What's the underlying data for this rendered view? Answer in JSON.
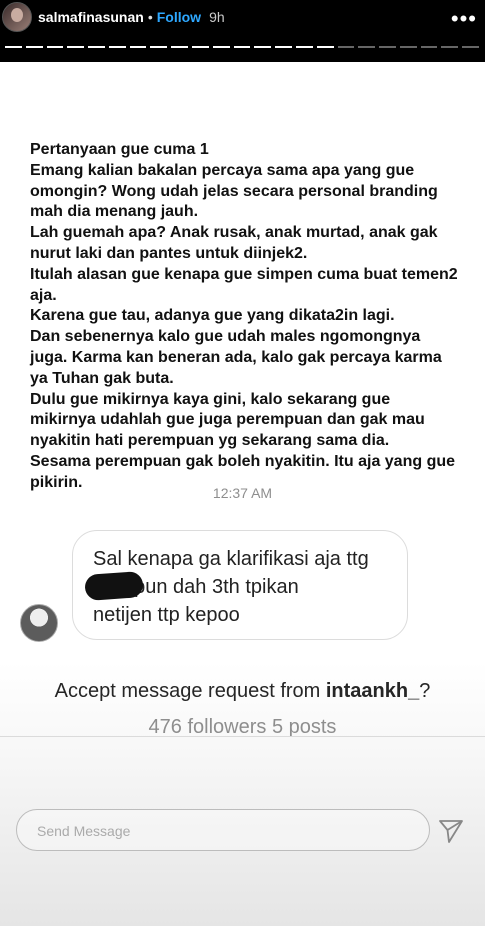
{
  "story_header": {
    "username": "salmafinasunan",
    "dot": "•",
    "follow_label": "Follow",
    "time": "9h",
    "more_icon": "more-dots-icon",
    "progress": {
      "segments_total": 23,
      "segments_viewed": 16
    }
  },
  "conversation": {
    "message_text": "Pertanyaan gue cuma 1\nEmang kalian bakalan percaya sama apa yang gue omongin? Wong udah jelas secara personal branding mah dia menang jauh.\nLah guemah apa? Anak rusak, anak murtad, anak gak nurut laki dan pantes untuk diinjek2.\nItulah alasan gue kenapa gue simpen cuma buat temen2 aja.\nKarena gue tau, adanya gue yang dikata2in lagi.\nDan sebenernya kalo gue udah males ngomongnya juga. Karma kan beneran ada, kalo gak percaya karma ya Tuhan gak buta.\nDulu gue mikirnya kaya gini, kalo sekarang gue mikirnya udahlah gue juga perempuan dan gak mau nyakitin hati perempuan yg sekarang sama dia.\nSesama perempuan gak boleh nyakitin. Itu aja yang gue pikirin.",
    "timestamp": "12:37 AM",
    "incoming_bubble": "Sal kenapa ga klarifikasi aja ttg\n               walopun dah 3th tpikan\nnetijen ttp kepoo"
  },
  "request": {
    "prefix": "Accept message request from ",
    "handle": "intaankh_",
    "suffix": "?",
    "stats": "476 followers 5 posts"
  },
  "reply": {
    "placeholder": "Send Message",
    "send_icon": "send-icon"
  },
  "colors": {
    "accent": "#2ea8ff",
    "text_dark": "#111111",
    "text_muted": "#8e8e8e"
  }
}
